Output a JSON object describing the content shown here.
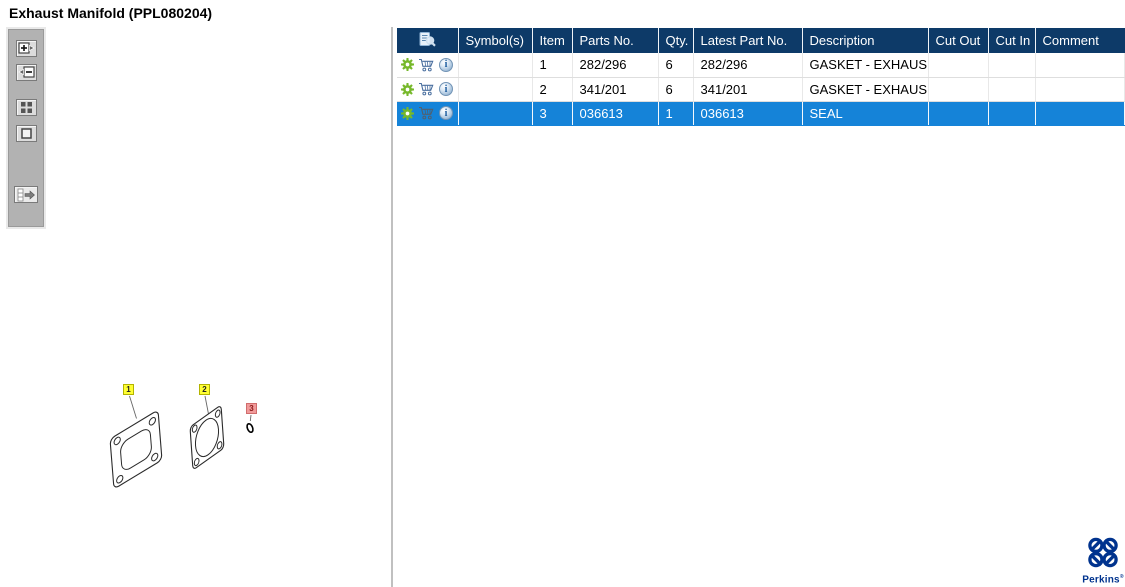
{
  "title": "Exhaust Manifold (PPL080204)",
  "colors": {
    "header_bg": "#0d3a68",
    "selected_row_bg": "#1583d8",
    "gear_green": "#76b82a",
    "cart_blue": "#4a6f9f",
    "perkins_blue": "#00338e",
    "callout_yellow": "#ffff33",
    "callout_red": "#f09a9a"
  },
  "viewer_toolbar": {
    "buttons": [
      {
        "icon": "zoom-in-icon"
      },
      {
        "icon": "zoom-out-icon"
      },
      {
        "icon": "tile-view-icon"
      },
      {
        "icon": "fit-to-window-icon"
      },
      {
        "icon": "toggle-parts-list-icon"
      }
    ]
  },
  "diagram": {
    "callouts": [
      {
        "label": "1",
        "style": "normal"
      },
      {
        "label": "2",
        "style": "normal"
      },
      {
        "label": "3",
        "style": "selected"
      }
    ],
    "parts": [
      "gasket-1",
      "gasket-2",
      "seal-3"
    ]
  },
  "table": {
    "columns": [
      "Symbol(s)",
      "Item",
      "Parts No.",
      "Qty.",
      "Latest Part No.",
      "Description",
      "Cut Out",
      "Cut In",
      "Comment"
    ],
    "header_icon": "table-search-icon",
    "row_icons": [
      "gear-icon",
      "cart-icon",
      "info-icon"
    ],
    "rows": [
      {
        "item": "1",
        "symbols": "",
        "parts_no": "282/296",
        "qty": "6",
        "latest_part_no": "282/296",
        "description": "GASKET - EXHAUS",
        "cut_out": "",
        "cut_in": "",
        "comment": ""
      },
      {
        "item": "2",
        "symbols": "",
        "parts_no": "341/201",
        "qty": "6",
        "latest_part_no": "341/201",
        "description": "GASKET - EXHAUS",
        "cut_out": "",
        "cut_in": "",
        "comment": ""
      },
      {
        "item": "3",
        "symbols": "",
        "parts_no": "036613",
        "qty": "1",
        "latest_part_no": "036613",
        "description": "SEAL",
        "cut_out": "",
        "cut_in": "",
        "comment": ""
      }
    ],
    "selected_row_index": 2
  },
  "logo": {
    "text": "Perkins",
    "mark": "®"
  }
}
